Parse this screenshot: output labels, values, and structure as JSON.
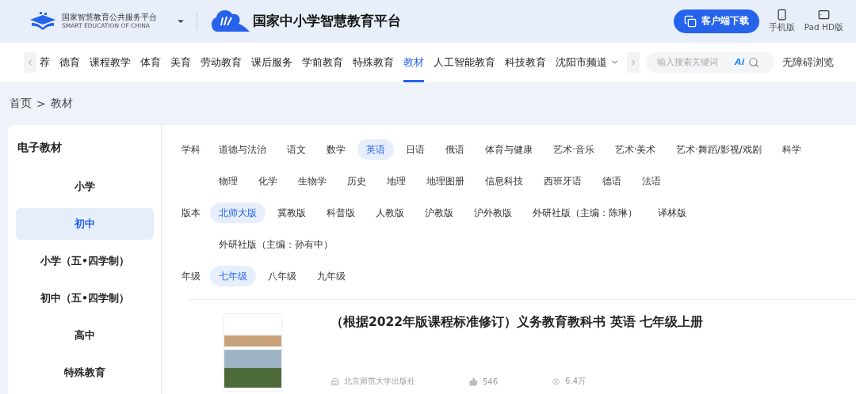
{
  "header": {
    "platform_name": "国家智慧教育公共服务平台",
    "platform_name_en": "SMART EDUCATION OF CHINA",
    "site_title": "国家中小学智慧教育平台",
    "download_button": "客户端下载",
    "devices": [
      {
        "kind": "phone",
        "label": "手机版"
      },
      {
        "kind": "tablet",
        "label": "Pad HD版"
      }
    ]
  },
  "nav": {
    "items": [
      {
        "label": "荐",
        "selected": false,
        "has_menu": false
      },
      {
        "label": "德育",
        "selected": false,
        "has_menu": false
      },
      {
        "label": "课程教学",
        "selected": false,
        "has_menu": false
      },
      {
        "label": "体育",
        "selected": false,
        "has_menu": false
      },
      {
        "label": "美育",
        "selected": false,
        "has_menu": false
      },
      {
        "label": "劳动教育",
        "selected": false,
        "has_menu": false
      },
      {
        "label": "课后服务",
        "selected": false,
        "has_menu": false
      },
      {
        "label": "学前教育",
        "selected": false,
        "has_menu": false
      },
      {
        "label": "特殊教育",
        "selected": false,
        "has_menu": false
      },
      {
        "label": "教材",
        "selected": true,
        "has_menu": false
      },
      {
        "label": "人工智能教育",
        "selected": false,
        "has_menu": false
      },
      {
        "label": "科技教育",
        "selected": false,
        "has_menu": false
      },
      {
        "label": "沈阳市频道",
        "selected": false,
        "has_menu": true
      }
    ],
    "search": {
      "placeholder": "输入搜索关键词",
      "ai_label": "Ai"
    },
    "accessibility": "无障碍浏览"
  },
  "breadcrumb": [
    "首页",
    ">",
    "教材"
  ],
  "sidebar": {
    "title": "电子教材",
    "items": [
      {
        "label": "小学",
        "selected": false
      },
      {
        "label": "初中",
        "selected": true
      },
      {
        "label": "小学（五•四学制）",
        "selected": false
      },
      {
        "label": "初中（五•四学制）",
        "selected": false
      },
      {
        "label": "高中",
        "selected": false
      },
      {
        "label": "特殊教育",
        "selected": false
      }
    ]
  },
  "filters": [
    {
      "label": "学科",
      "options": [
        {
          "label": "道德与法治",
          "selected": false
        },
        {
          "label": "语文",
          "selected": false
        },
        {
          "label": "数学",
          "selected": false
        },
        {
          "label": "英语",
          "selected": true
        },
        {
          "label": "日语",
          "selected": false
        },
        {
          "label": "俄语",
          "selected": false
        },
        {
          "label": "体育与健康",
          "selected": false
        },
        {
          "label": "艺术·音乐",
          "selected": false
        },
        {
          "label": "艺术·美术",
          "selected": false
        },
        {
          "label": "艺术·舞蹈/影视/戏剧",
          "selected": false
        },
        {
          "label": "科学",
          "selected": false
        },
        {
          "label": "物理",
          "selected": false
        },
        {
          "label": "化学",
          "selected": false
        },
        {
          "label": "生物学",
          "selected": false
        },
        {
          "label": "历史",
          "selected": false
        },
        {
          "label": "地理",
          "selected": false
        },
        {
          "label": "地理图册",
          "selected": false
        },
        {
          "label": "信息科技",
          "selected": false
        },
        {
          "label": "西班牙语",
          "selected": false
        },
        {
          "label": "德语",
          "selected": false
        },
        {
          "label": "法语",
          "selected": false
        }
      ]
    },
    {
      "label": "版本",
      "options": [
        {
          "label": "北师大版",
          "selected": true
        },
        {
          "label": "冀教版",
          "selected": false
        },
        {
          "label": "科普版",
          "selected": false
        },
        {
          "label": "人教版",
          "selected": false
        },
        {
          "label": "沪教版",
          "selected": false
        },
        {
          "label": "沪外教版",
          "selected": false
        },
        {
          "label": "外研社版（主编：陈琳）",
          "selected": false
        },
        {
          "label": "译林版",
          "selected": false
        },
        {
          "label": "外研社版（主编：孙有中）",
          "selected": false
        }
      ]
    },
    {
      "label": "年级",
      "options": [
        {
          "label": "七年级",
          "selected": true
        },
        {
          "label": "八年级",
          "selected": false
        },
        {
          "label": "九年级",
          "selected": false
        }
      ]
    }
  ],
  "books": [
    {
      "title": "（根据2022年版课程标准修订）义务教育教科书 英语 七年级上册",
      "publisher": "北京师范大学出版社",
      "likes": "546",
      "views": "6.4万"
    }
  ]
}
